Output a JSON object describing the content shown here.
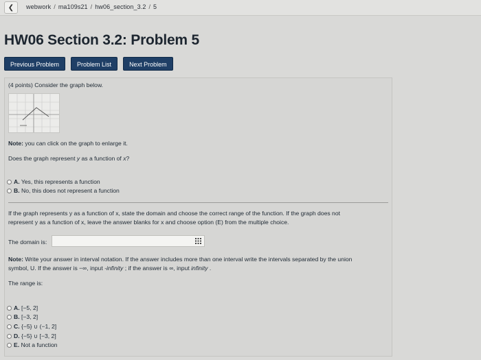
{
  "breadcrumb": {
    "back_icon": "chevron-left-icon",
    "items": [
      "webwork",
      "ma109s21",
      "hw06_section_3.2",
      "5"
    ]
  },
  "page": {
    "title": "HW06 Section 3.2: Problem 5"
  },
  "nav": {
    "previous_label": "Previous Problem",
    "list_label": "Problem List",
    "next_label": "Next Problem"
  },
  "problem": {
    "intro": "(4 points) Consider the graph below.",
    "note_label": "Note:",
    "note_text": " you can click on the graph to enlarge it.",
    "q1_pre": "Does the graph represent ",
    "q1_y": "y",
    "q1_mid": " as a function of ",
    "q1_x": "x",
    "q1_post": "?",
    "q1_options": [
      {
        "letter": "A.",
        "text": " Yes, this represents a function"
      },
      {
        "letter": "B.",
        "text": " No, this does not represent a function"
      }
    ],
    "instr_line1": "If the graph represents y as a function of x, state the domain and choose the correct range of the function. If the graph does not",
    "instr_line2": "represent y as a function of x, leave the answer blanks for x and choose option (E) from the multiple choice.",
    "domain_label": "The domain is:",
    "domain_value": "",
    "note2_label": "Note:",
    "note2_line1": " Write your answer in interval notation. If the answer includes more than one interval write the intervals separated by the union",
    "note2_line2a": "symbol, U. If the answer is −∞, input ",
    "note2_infneg": "-infinity",
    "note2_line2b": " ; if the answer is ∞, input ",
    "note2_infpos": "infinity",
    "note2_line2c": " .",
    "range_label": "The range is:",
    "range_options": [
      {
        "letter": "A.",
        "text": " [−5, 2]"
      },
      {
        "letter": "B.",
        "text": " [−3, 2]"
      },
      {
        "letter": "C.",
        "text": " {−5} ∪ (−1, 2]"
      },
      {
        "letter": "D.",
        "text": " {−5} ∪ [−3, 2]"
      },
      {
        "letter": "E.",
        "text": " Not a function"
      }
    ]
  },
  "colors": {
    "nav_button_bg": "#1f3f66",
    "page_bg": "#d9d9d7"
  }
}
